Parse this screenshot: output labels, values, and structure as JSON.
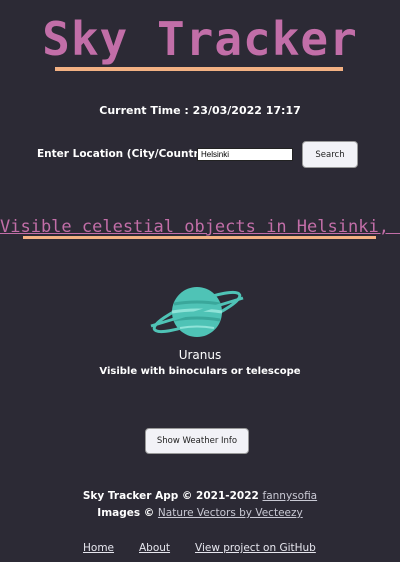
{
  "app": {
    "title": "Sky Tracker"
  },
  "time": {
    "label": "Current Time : 23/03/2022 17:17"
  },
  "location": {
    "label": "Enter Location (City/Country):",
    "value": "Helsinki",
    "search_label": "Search"
  },
  "results": {
    "heading": "Visible celestial objects in Helsinki, FI",
    "objects": [
      {
        "name": "Uranus",
        "visibility": "Visible with binoculars or telescope",
        "icon": "uranus-planet-icon"
      }
    ]
  },
  "weather_button": "Show Weather Info",
  "footer": {
    "copyright": "Sky Tracker App © 2021-2022",
    "author_link": "fannysofia",
    "images_prefix": "Images ©",
    "images_link": "Nature Vectors by Vecteezy",
    "nav": [
      "Home",
      "About",
      "View project on GitHub"
    ]
  },
  "colors": {
    "background": "#2c2a35",
    "accent": "#c26ea8",
    "underline": "#f3b183",
    "planet": "#4fc3b6"
  }
}
